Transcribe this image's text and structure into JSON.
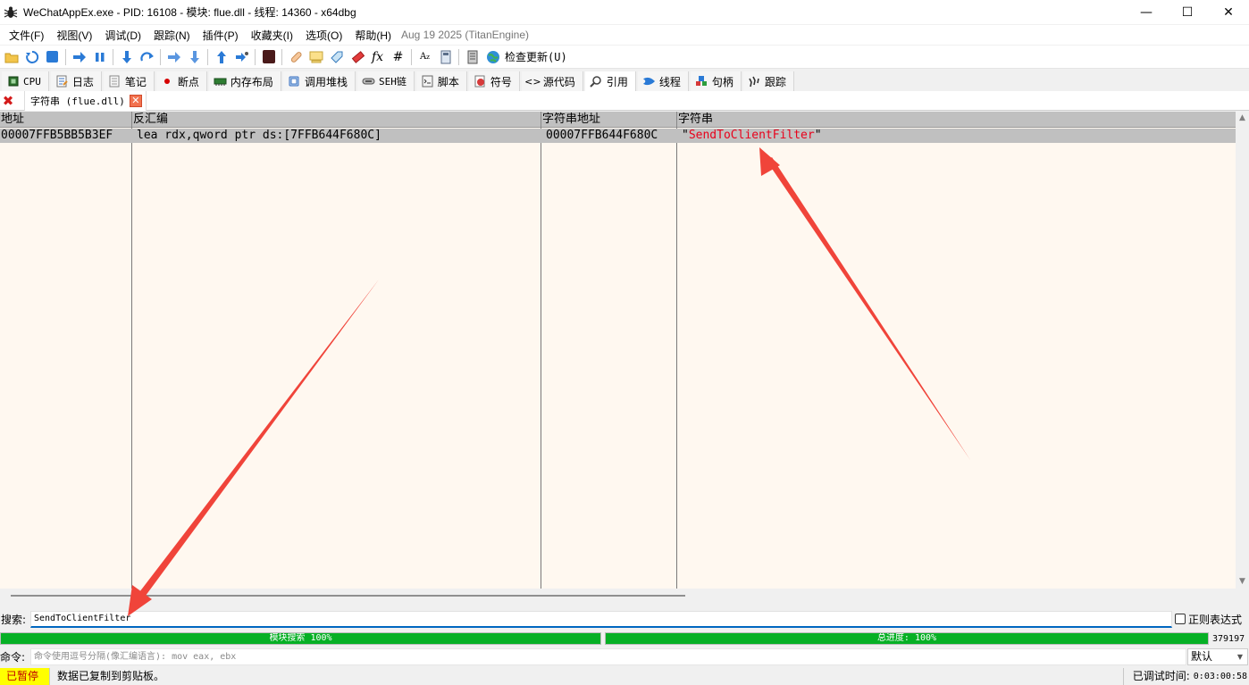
{
  "window": {
    "title": "WeChatAppEx.exe - PID: 16108 - 模块: flue.dll - 线程: 14360 - x64dbg",
    "minimize": "—",
    "maximize": "☐",
    "close": "✕"
  },
  "menu": {
    "items": [
      "文件(F)",
      "视图(V)",
      "调试(D)",
      "跟踪(N)",
      "插件(P)",
      "收藏夹(I)",
      "选项(O)",
      "帮助(H)"
    ],
    "build_info": "Aug 19 2025 (TitanEngine)"
  },
  "toolbar": {
    "update_label": "检查更新(U)"
  },
  "tabs": [
    {
      "label": "CPU",
      "icon": "cpu-icon"
    },
    {
      "label": "日志",
      "icon": "log-icon"
    },
    {
      "label": "笔记",
      "icon": "notes-icon"
    },
    {
      "label": "断点",
      "icon": "breakpoint-icon"
    },
    {
      "label": "内存布局",
      "icon": "memory-map-icon"
    },
    {
      "label": "调用堆栈",
      "icon": "callstack-icon"
    },
    {
      "label": "SEH链",
      "icon": "seh-icon"
    },
    {
      "label": "脚本",
      "icon": "script-icon"
    },
    {
      "label": "符号",
      "icon": "symbols-icon"
    },
    {
      "label": "源代码",
      "icon": "source-icon"
    },
    {
      "label": "引用",
      "icon": "references-icon"
    },
    {
      "label": "线程",
      "icon": "threads-icon"
    },
    {
      "label": "句柄",
      "icon": "handles-icon"
    },
    {
      "label": "跟踪",
      "icon": "trace-icon"
    }
  ],
  "active_tab": "引用",
  "subtab": {
    "label": "字符串 (flue.dll)"
  },
  "table": {
    "headers": [
      "地址",
      "反汇编",
      "字符串地址",
      "字符串"
    ],
    "rows": [
      {
        "address": "00007FFB5BB5B3EF",
        "disasm": "lea rdx,qword ptr ds:[7FFB644F680C]",
        "string_address": "00007FFB644F680C",
        "quote_open": "\"",
        "string": "SendToClientFilter",
        "quote_close": "\""
      }
    ]
  },
  "search": {
    "label": "搜索:",
    "value": "SendToClientFilter",
    "regex_label": "正则表达式",
    "regex_checked": false
  },
  "progress": {
    "module_label": "模块搜索 100%",
    "module_value": 100,
    "total_label": "总进度: 100%",
    "total_value": 100,
    "count": "379197"
  },
  "command": {
    "label": "命令:",
    "placeholder": "命令使用逗号分隔(像汇编语言): mov eax, ebx",
    "mode": "默认"
  },
  "status": {
    "state": "已暂停",
    "message": "数据已复制到剪贴板。",
    "timer_label": "已调试时间:",
    "timer": "0:03:00:58"
  },
  "colors": {
    "table_bg": "#fff8f0",
    "header_bg": "#c0c0c0",
    "string_red": "#e8001a",
    "progress_green": "#06b025",
    "paused_yellow": "#ffff00",
    "annotation_arrow": "#f0443a"
  }
}
